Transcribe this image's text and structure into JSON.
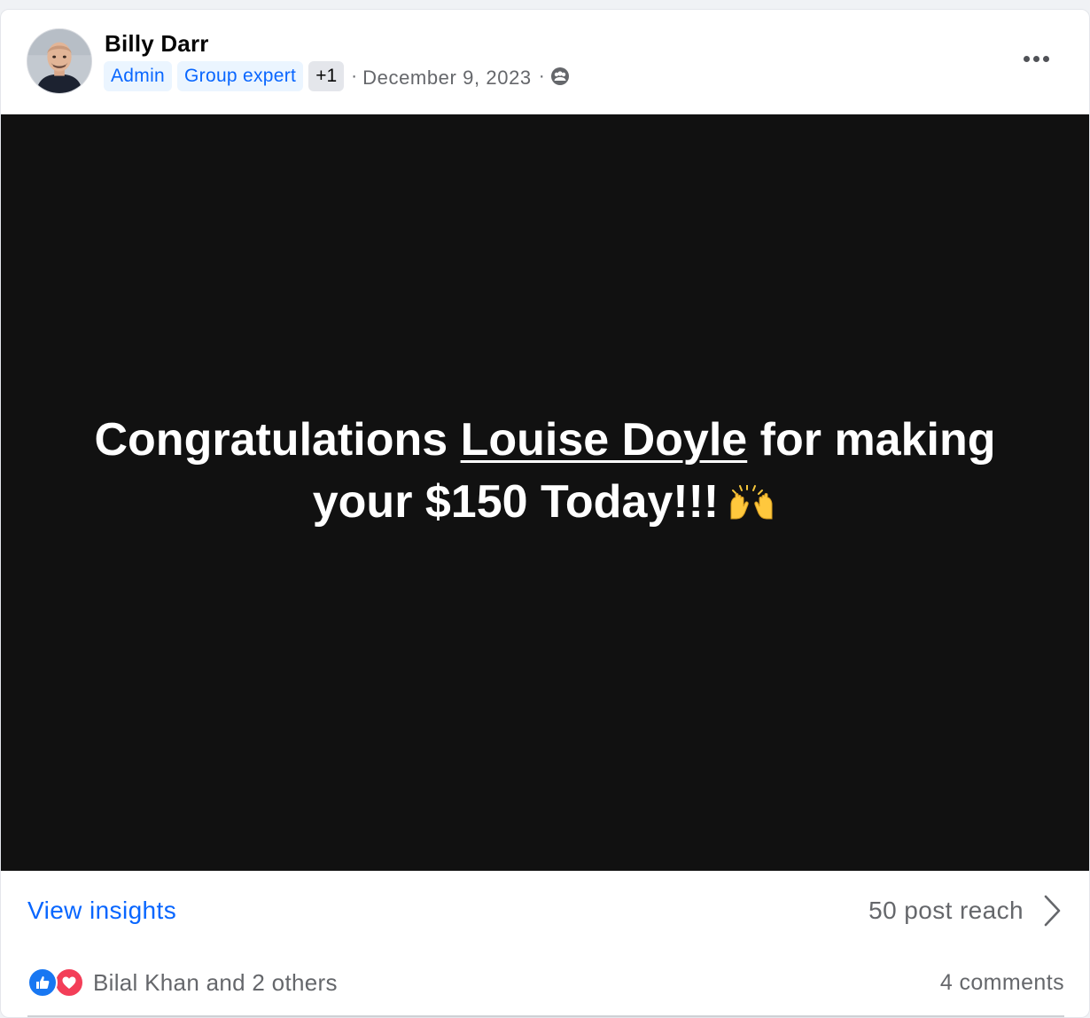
{
  "post": {
    "author": "Billy Darr",
    "badges": [
      "Admin",
      "Group expert"
    ],
    "badge_more": "+1",
    "separator": "·",
    "date": "December 9, 2023",
    "privacy_icon": "members-group-icon",
    "more_icon": "more-horizontal-icon"
  },
  "media": {
    "text_before": "Congratulations ",
    "mention": "Louise Doyle",
    "text_after": " for making your $150 Today!!!",
    "emoji": "raising-hands-emoji",
    "background": "#111111"
  },
  "insights": {
    "view_label": "View insights",
    "reach_label": "50 post reach",
    "chevron_icon": "chevron-right-icon"
  },
  "reactions": {
    "icons": [
      "like-icon",
      "love-icon"
    ],
    "names_label": "Bilal Khan and 2 others",
    "comments_label": "4 comments"
  },
  "colors": {
    "link_blue": "#0866ff",
    "badge_bg": "#ebf5ff",
    "muted_text": "#65676b",
    "like_blue": "#1877f2",
    "love_red": "#f33e58"
  }
}
